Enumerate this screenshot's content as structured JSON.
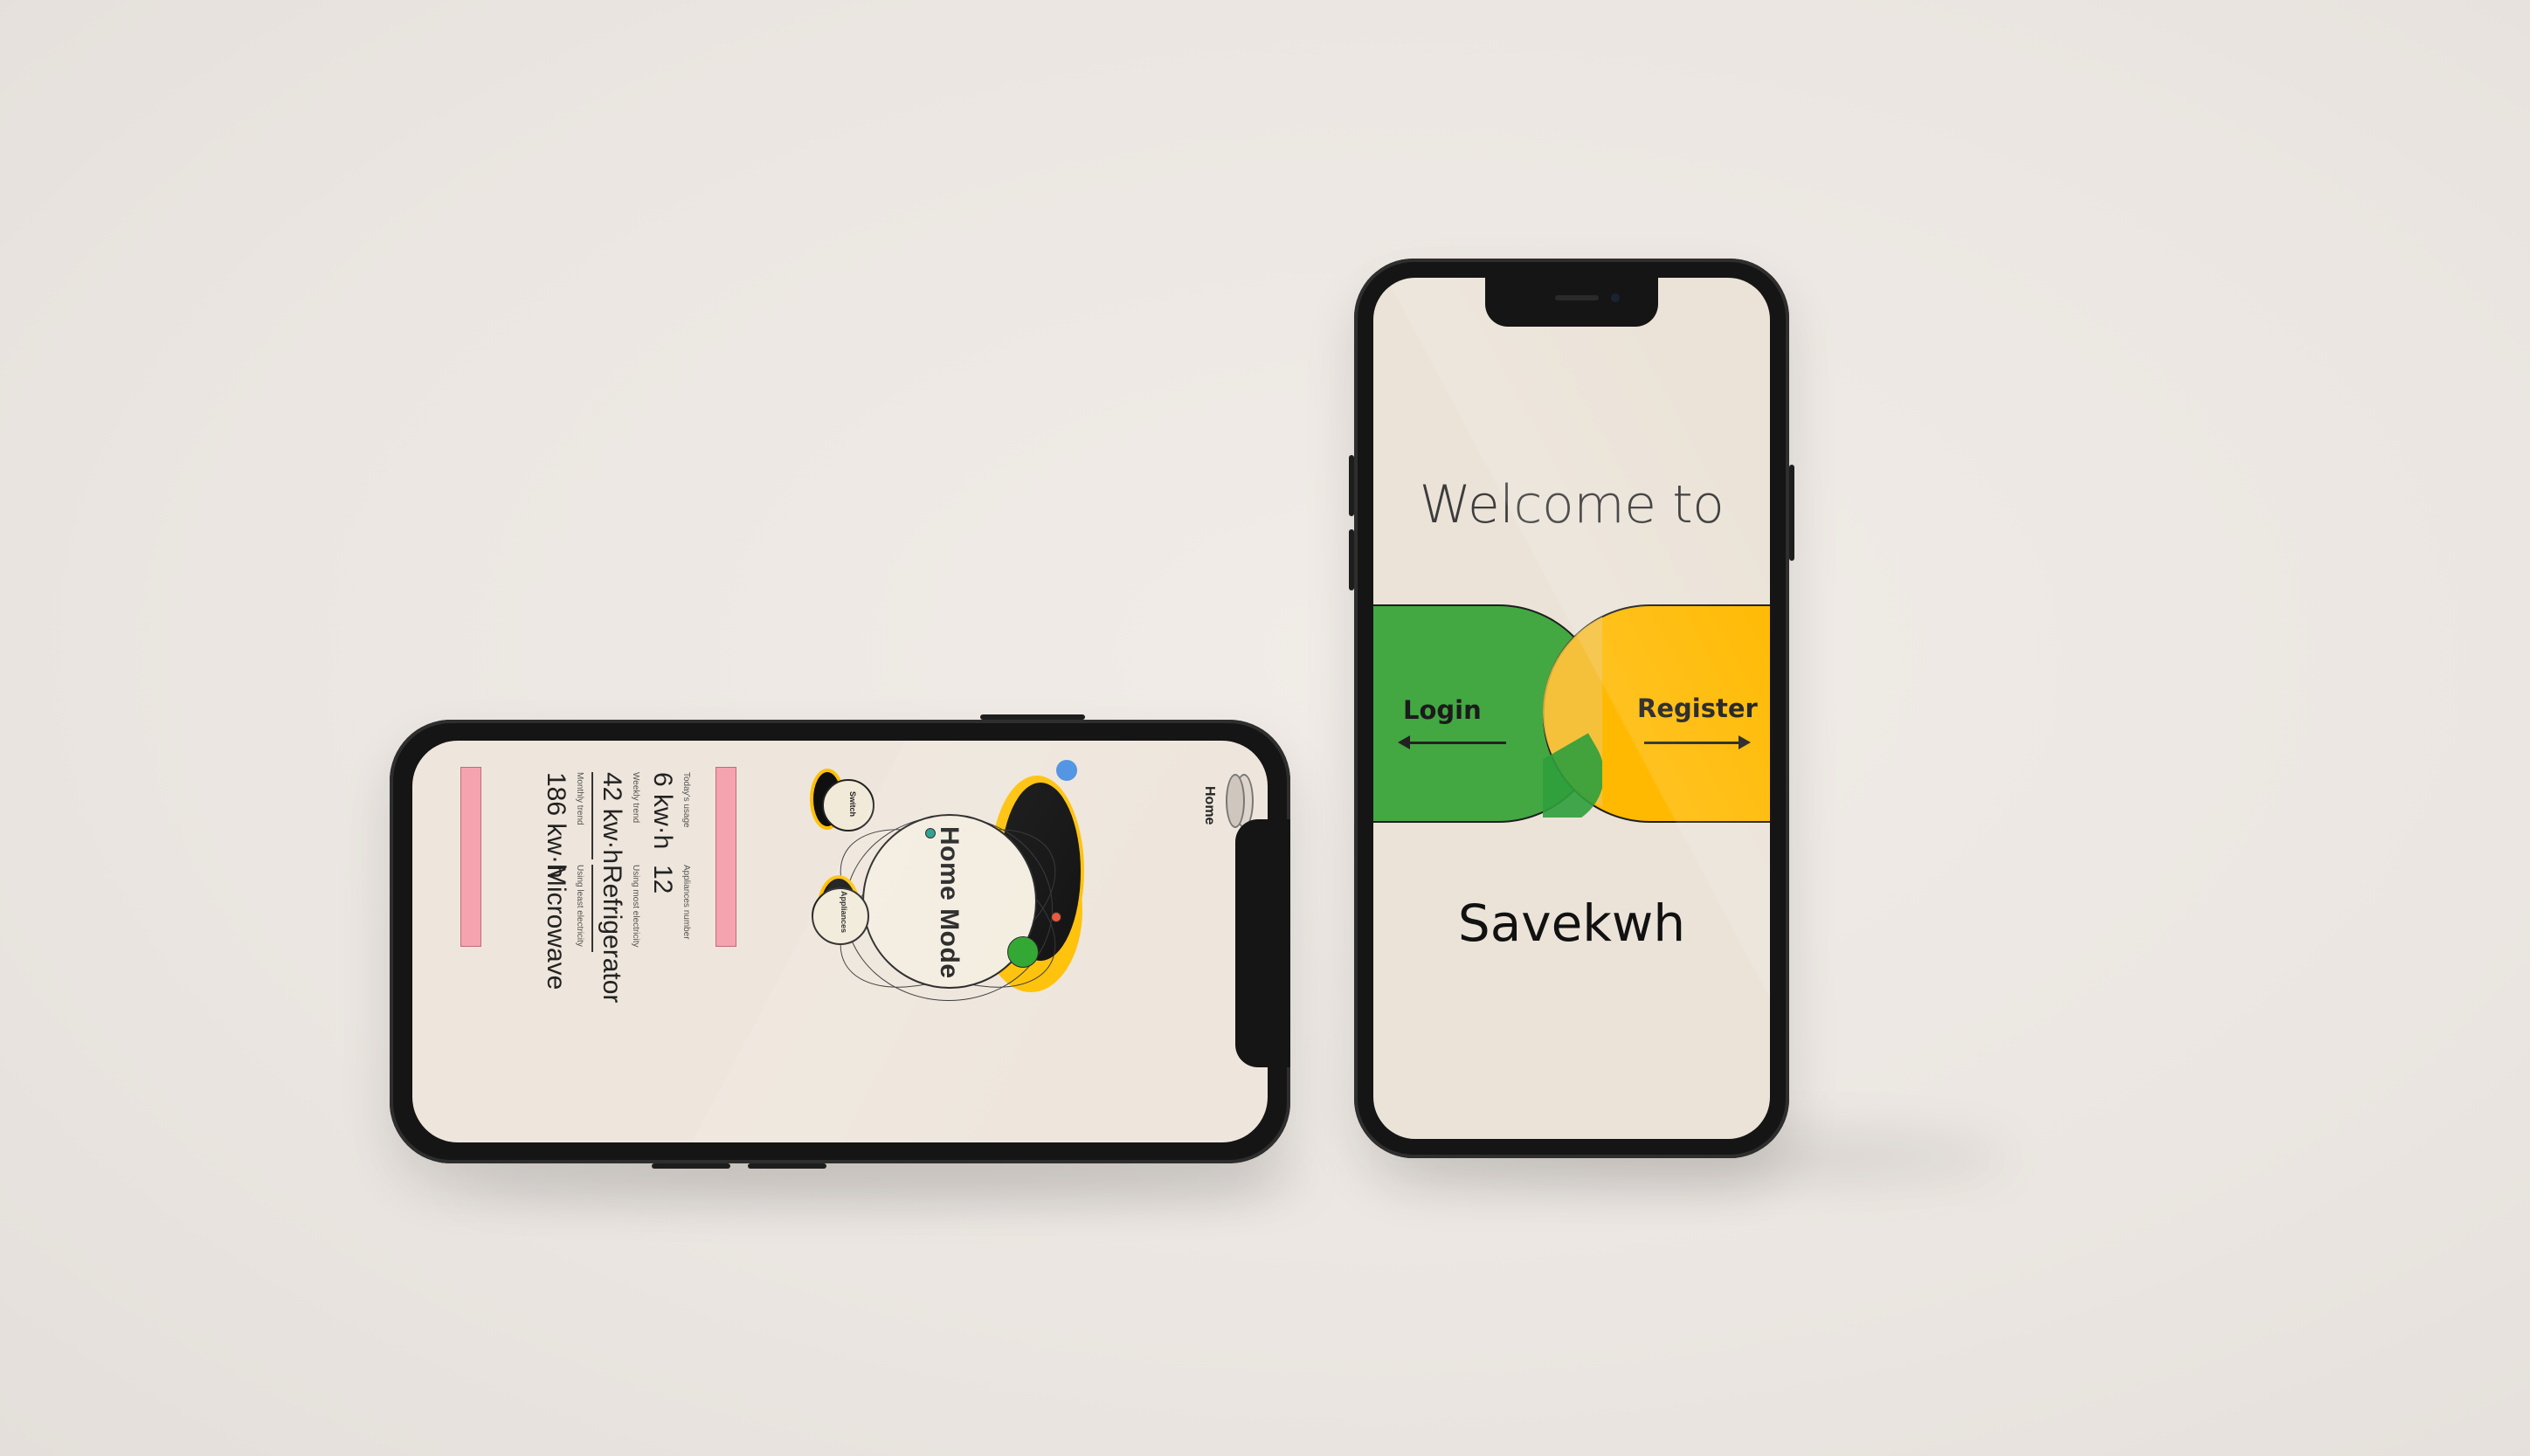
{
  "landscape_screen": {
    "nav_tab": "Home",
    "mode_title": "Home Mode",
    "switch_label": "Switch",
    "appliances_label": "Appliances",
    "stats": {
      "todays_usage_label": "Today's usage",
      "todays_usage_value": "6 kw·h",
      "appliances_number_label": "Appliances number",
      "appliances_number_value": "12",
      "weekly_trend_label": "Weekly trend",
      "weekly_trend_value": "42 kw·h",
      "most_electricity_label": "Using most electricity",
      "most_electricity_value": "Refrigerator",
      "monthly_trend_label": "Monthly trend",
      "monthly_trend_value": "186 kw·h",
      "least_electricity_label": "Using least electricity",
      "least_electricity_value": "Microwave"
    }
  },
  "portrait_screen": {
    "welcome_text": "Welcome to",
    "login_label": "Login",
    "register_label": "Register",
    "app_name": "Savekwh"
  },
  "colors": {
    "background": "#ece7e2",
    "screen": "#ebe3d8",
    "login_green": "#43a842",
    "register_yellow": "#ffb900",
    "bar_pink": "#f5a3ae",
    "planet_blue": "#4a90e2",
    "planet_green": "#2ca52c",
    "planet_red": "#e8553a",
    "planet_teal": "#1f9a8a"
  }
}
